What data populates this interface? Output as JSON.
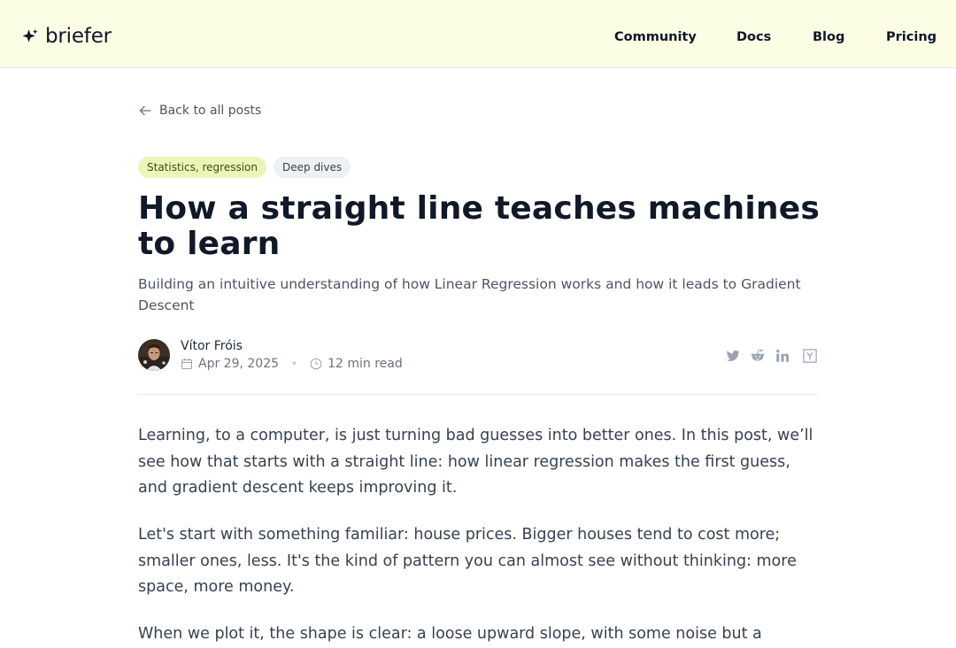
{
  "header": {
    "logo_text": "briefer",
    "nav": [
      "Community",
      "Docs",
      "Blog",
      "Pricing"
    ],
    "background": "#fbfde4"
  },
  "back_link": {
    "label": "Back to all posts"
  },
  "tags": [
    "Statistics, regression",
    "Deep dives"
  ],
  "article": {
    "title": "How a straight line teaches machines to learn",
    "subtitle": "Building an intuitive understanding of how Linear Regression works and how it leads to Gradient Descent",
    "author": "Vítor Fróis",
    "date": "Apr 29, 2025",
    "read_time": "12 min read",
    "share_icons": [
      "twitter-icon",
      "reddit-icon",
      "linkedin-icon",
      "hacker-news-icon"
    ],
    "paragraphs": [
      "Learning, to a computer, is just turning bad guesses into better ones. In this post, we’ll see how that starts with a straight line: how linear regression makes the first guess, and gradient descent keeps improving it.",
      "Let's start with something familiar: house prices. Bigger houses tend to cost more; smaller ones, less. It's the kind of pattern you can almost see without thinking: more space, more money.",
      "When we plot it, the shape is clear: a loose upward slope, with some noise but a"
    ]
  }
}
